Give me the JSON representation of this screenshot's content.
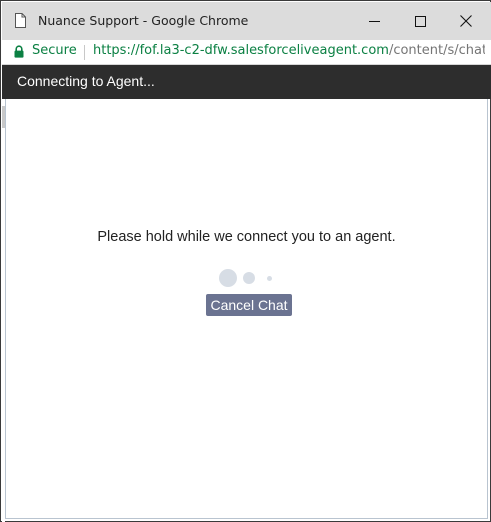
{
  "window": {
    "title": "Nuance Support - Google Chrome",
    "icons": {
      "page": "page-icon",
      "minimize": "minimize-icon",
      "maximize": "maximize-icon",
      "close": "close-icon"
    }
  },
  "addressbar": {
    "secure_label": "Secure",
    "url_host": "https://fof.la3-c2-dfw.salesforceliveagent.com",
    "url_path": "/content/s/chat...",
    "lock_icon": "lock-icon",
    "secure_color": "#0b8043"
  },
  "chat": {
    "header_status": "Connecting to Agent...",
    "hold_message": "Please hold while we connect you to an agent.",
    "cancel_label": "Cancel Chat",
    "header_color": "#2d2d2d",
    "button_color": "#6b7391",
    "loader_icon": "loading-dots-icon"
  }
}
